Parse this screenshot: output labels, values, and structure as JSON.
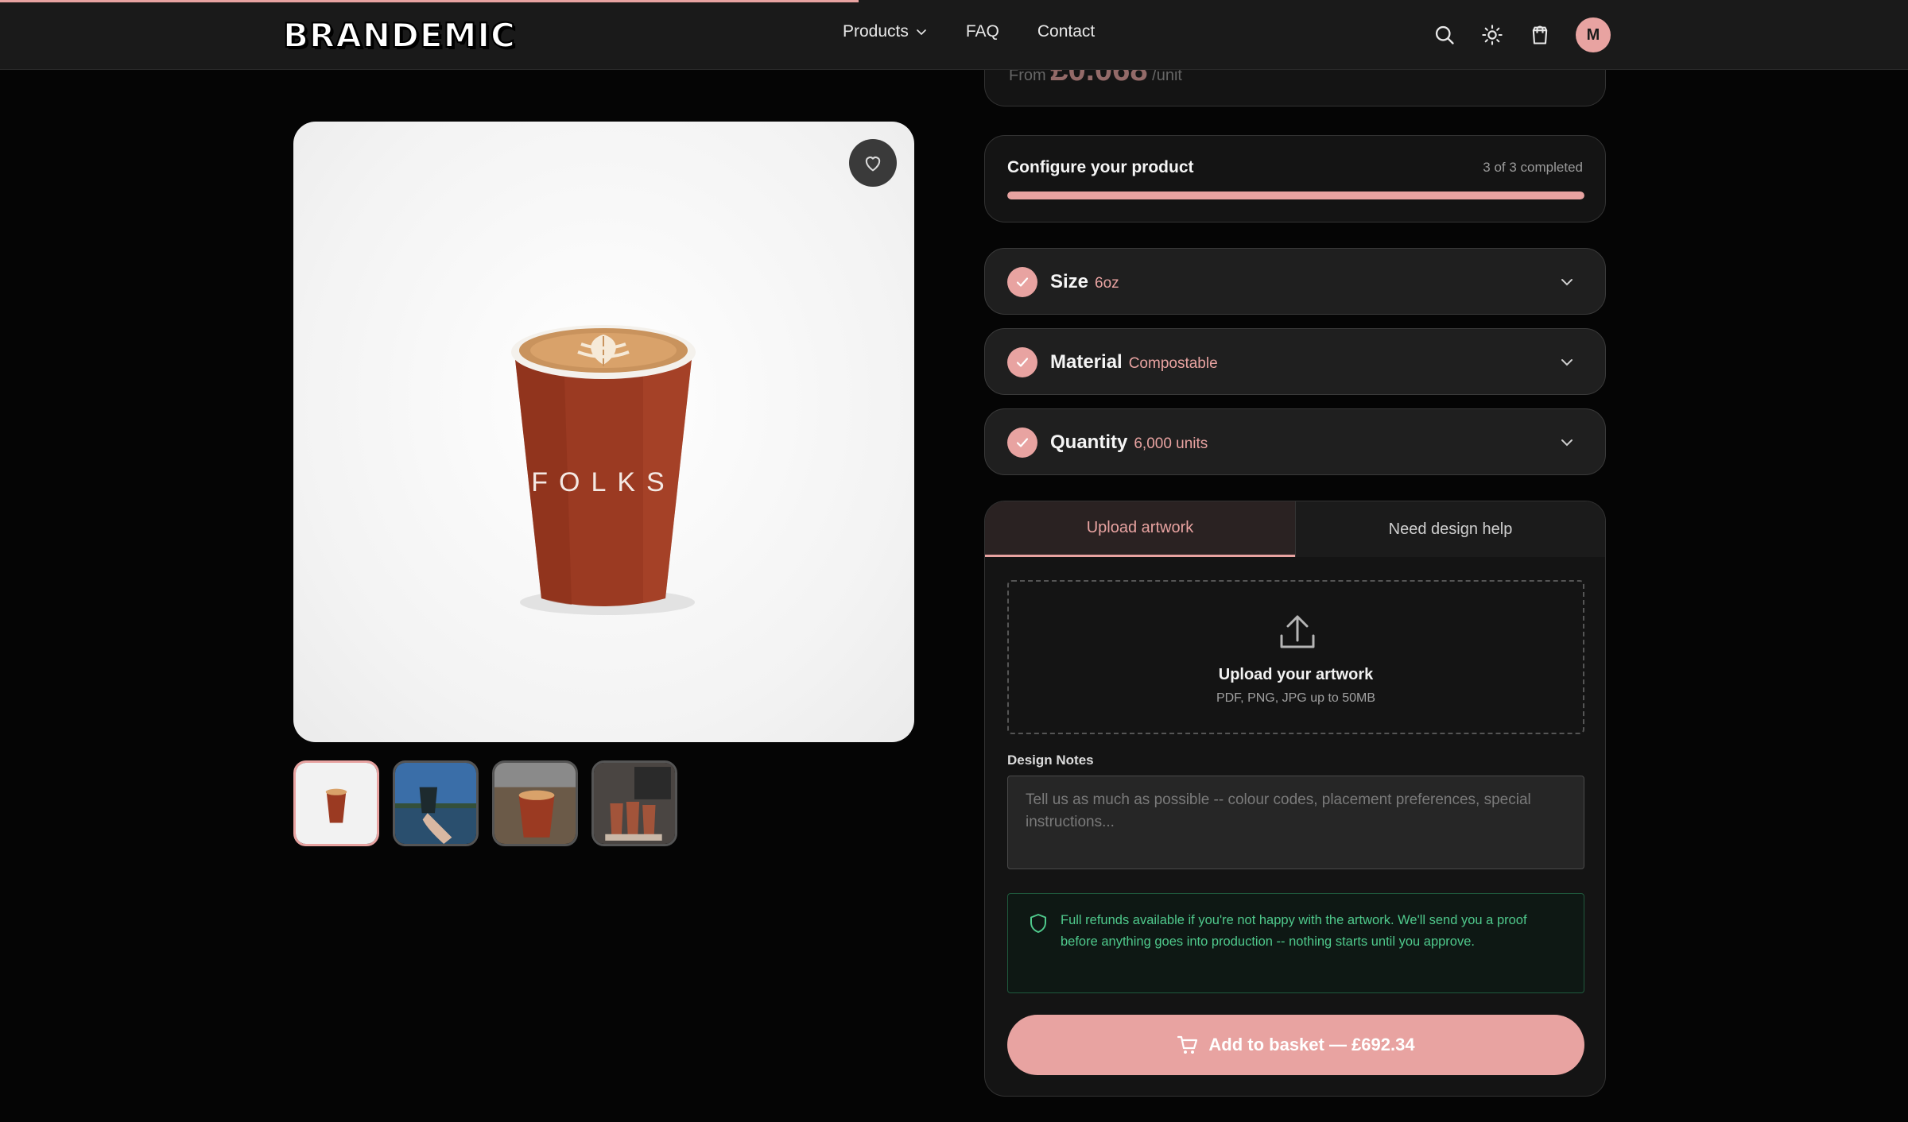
{
  "brand": {
    "logo_text": "BRANDEMIC",
    "accent": "#e8a3a1"
  },
  "page_progress": 0.45,
  "nav": {
    "items": [
      {
        "label": "Products",
        "has_dropdown": true
      },
      {
        "label": "FAQ"
      },
      {
        "label": "Contact"
      }
    ]
  },
  "header_icons": [
    "search-icon",
    "sun-icon",
    "cart-icon"
  ],
  "user": {
    "avatar_initial": "M"
  },
  "gallery": {
    "main_image": {
      "cup_print": "FOLKS"
    },
    "thumbnails": [
      "cup-white-background",
      "cup-held-lake",
      "cup-on-table",
      "cup-stack-store"
    ],
    "active_index": 0
  },
  "price": {
    "prefix": "From",
    "amount": "£0.068",
    "suffix": "/unit"
  },
  "configure": {
    "title": "Configure your product",
    "status": "3 of 3 completed",
    "progress": 1.0
  },
  "options": [
    {
      "label": "Size",
      "value": "6oz"
    },
    {
      "label": "Material",
      "value": "Compostable"
    },
    {
      "label": "Quantity",
      "value": "6,000 units"
    }
  ],
  "artwork": {
    "tabs": [
      "Upload artwork",
      "Need design help"
    ],
    "active_tab": 0,
    "dropzone_title": "Upload your artwork",
    "dropzone_sub": "PDF, PNG, JPG up to 50MB",
    "notes_label": "Design Notes",
    "notes_placeholder": "Tell us as much as possible -- colour codes, placement preferences, special instructions...",
    "notes_value": "",
    "notice": "Full refunds available if you're not happy with the artwork. We'll send you a proof before anything goes into production -- nothing starts until you approve.",
    "add_button": "Add to basket — £692.34"
  }
}
